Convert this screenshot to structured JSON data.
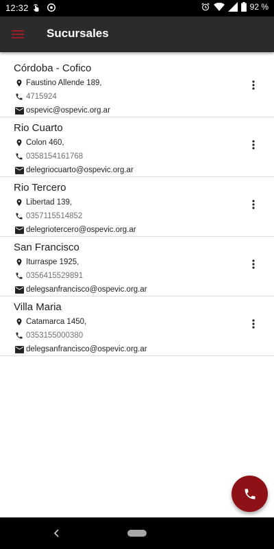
{
  "status_bar": {
    "time": "12:32",
    "battery": "92 %"
  },
  "app_bar": {
    "title": "Sucursales",
    "menu_icon": "hamburger-menu-icon",
    "accent": "#9b1c22"
  },
  "branches": [
    {
      "name": "Córdoba - Cofico",
      "address": "Faustino Allende 189,",
      "phone": "4715924",
      "email": "ospevic@ospevic.org.ar"
    },
    {
      "name": "Rio Cuarto",
      "address": "Colon 460,",
      "phone": "0358154161768",
      "email": "delegriocuarto@ospevic.org.ar"
    },
    {
      "name": "Rio Tercero",
      "address": "Libertad 139,",
      "phone": "0357115514852",
      "email": "delegriotercero@ospevic.org.ar"
    },
    {
      "name": "San Francisco",
      "address": "Iturraspe 1925,",
      "phone": "0356415529891",
      "email": "delegsanfrancisco@ospevic.org.ar"
    },
    {
      "name": "Villa Maria",
      "address": "Catamarca 1450,",
      "phone": "0353155000380",
      "email": "delegsanfrancisco@ospevic.org.ar"
    }
  ],
  "fab": {
    "icon": "phone-icon",
    "color": "#8e1117"
  }
}
